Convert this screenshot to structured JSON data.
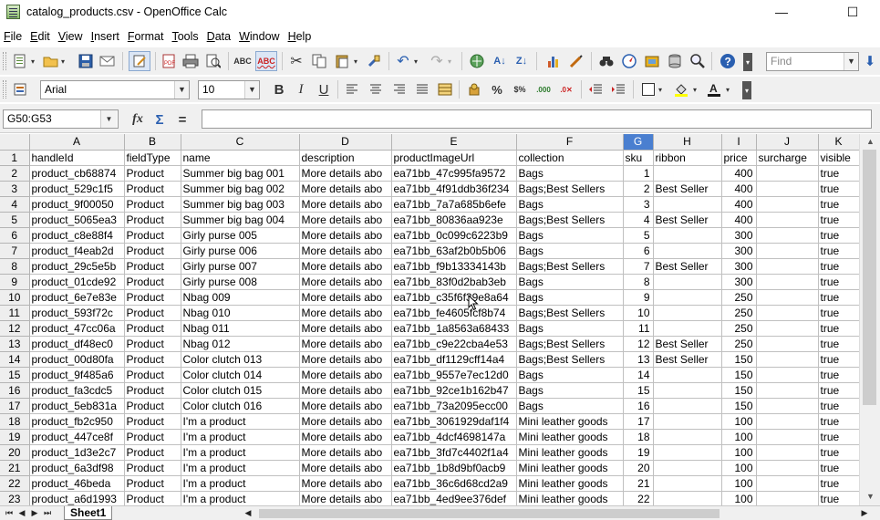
{
  "window": {
    "title": "catalog_products.csv - OpenOffice Calc",
    "minimize": "—",
    "maximize": "☐",
    "close": "✕"
  },
  "menu": [
    "File",
    "Edit",
    "View",
    "Insert",
    "Format",
    "Tools",
    "Data",
    "Window",
    "Help"
  ],
  "toolbar": {
    "find_placeholder": "Find",
    "font_name": "Arial",
    "font_size": "10"
  },
  "formula_bar": {
    "name_box": "G50:G53",
    "function_wizard": "fx",
    "sum": "Σ",
    "equals": "=",
    "formula": ""
  },
  "columns": [
    "A",
    "B",
    "C",
    "D",
    "E",
    "F",
    "G",
    "H",
    "I",
    "J",
    "K"
  ],
  "selected_column": "G",
  "rows": [
    {
      "n": "1",
      "cells": [
        "handleId",
        "fieldType",
        "name",
        "description",
        "productImageUrl",
        "collection",
        "sku",
        "ribbon",
        "price",
        "surcharge",
        "visible"
      ]
    },
    {
      "n": "2",
      "cells": [
        "product_cb68874",
        "Product",
        "Summer big bag 001",
        "More details abo",
        "ea71bb_47c995fa9572",
        "Bags",
        "1",
        "",
        "400",
        "",
        "true"
      ]
    },
    {
      "n": "3",
      "cells": [
        "product_529c1f5",
        "Product",
        "Summer big bag 002",
        "More details abo",
        "ea71bb_4f91ddb36f234",
        "Bags;Best Sellers",
        "2",
        "Best Seller",
        "400",
        "",
        "true"
      ]
    },
    {
      "n": "4",
      "cells": [
        "product_9f00050",
        "Product",
        "Summer big bag 003",
        "More details abo",
        "ea71bb_7a7a685b6efe",
        "Bags",
        "3",
        "",
        "400",
        "",
        "true"
      ]
    },
    {
      "n": "5",
      "cells": [
        "product_5065ea3",
        "Product",
        "Summer big bag 004",
        "More details abo",
        "ea71bb_80836aa923e",
        "Bags;Best Sellers",
        "4",
        "Best Seller",
        "400",
        "",
        "true"
      ]
    },
    {
      "n": "6",
      "cells": [
        "product_c8e88f4",
        "Product",
        "Girly purse 005",
        "More details abo",
        "ea71bb_0c099c6223b9",
        "Bags",
        "5",
        "",
        "300",
        "",
        "true"
      ]
    },
    {
      "n": "7",
      "cells": [
        "product_f4eab2d",
        "Product",
        "Girly purse 006",
        "More details abo",
        "ea71bb_63af2b0b5b06",
        "Bags",
        "6",
        "",
        "300",
        "",
        "true"
      ]
    },
    {
      "n": "8",
      "cells": [
        "product_29c5e5b",
        "Product",
        "Girly purse 007",
        "More details abo",
        "ea71bb_f9b13334143b",
        "Bags;Best Sellers",
        "7",
        "Best Seller",
        "300",
        "",
        "true"
      ]
    },
    {
      "n": "9",
      "cells": [
        "product_01cde92",
        "Product",
        "Girly purse 008",
        "More details abo",
        "ea71bb_83f0d2bab3eb",
        "Bags",
        "8",
        "",
        "300",
        "",
        "true"
      ]
    },
    {
      "n": "10",
      "cells": [
        "product_6e7e83e",
        "Product",
        "Nbag 009",
        "More details abo",
        "ea71bb_c35f6f39e8a64",
        "Bags",
        "9",
        "",
        "250",
        "",
        "true"
      ]
    },
    {
      "n": "11",
      "cells": [
        "product_593f72c",
        "Product",
        "Nbag 010",
        "More details abo",
        "ea71bb_fe4605fcf8b74",
        "Bags;Best Sellers",
        "10",
        "",
        "250",
        "",
        "true"
      ]
    },
    {
      "n": "12",
      "cells": [
        "product_47cc06a",
        "Product",
        "Nbag 011",
        "More details abo",
        "ea71bb_1a8563a68433",
        "Bags",
        "11",
        "",
        "250",
        "",
        "true"
      ]
    },
    {
      "n": "13",
      "cells": [
        "product_df48ec0",
        "Product",
        "Nbag 012",
        "More details abo",
        "ea71bb_c9e22cba4e53",
        "Bags;Best Sellers",
        "12",
        "Best Seller",
        "250",
        "",
        "true"
      ]
    },
    {
      "n": "14",
      "cells": [
        "product_00d80fa",
        "Product",
        "Color clutch 013",
        "More details abo",
        "ea71bb_df1129cff14a4",
        "Bags;Best Sellers",
        "13",
        "Best Seller",
        "150",
        "",
        "true"
      ]
    },
    {
      "n": "15",
      "cells": [
        "product_9f485a6",
        "Product",
        "Color clutch 014",
        "More details abo",
        "ea71bb_9557e7ec12d0",
        "Bags",
        "14",
        "",
        "150",
        "",
        "true"
      ]
    },
    {
      "n": "16",
      "cells": [
        "product_fa3cdc5",
        "Product",
        "Color clutch 015",
        "More details abo",
        "ea71bb_92ce1b162b47",
        "Bags",
        "15",
        "",
        "150",
        "",
        "true"
      ]
    },
    {
      "n": "17",
      "cells": [
        "product_5eb831a",
        "Product",
        "Color clutch 016",
        "More details abo",
        "ea71bb_73a2095ecc00",
        "Bags",
        "16",
        "",
        "150",
        "",
        "true"
      ]
    },
    {
      "n": "18",
      "cells": [
        "product_fb2c950",
        "Product",
        "I'm a product",
        "More details abo",
        "ea71bb_3061929daf1f4",
        "Mini leather goods",
        "17",
        "",
        "100",
        "",
        "true"
      ]
    },
    {
      "n": "19",
      "cells": [
        "product_447ce8f",
        "Product",
        "I'm a product",
        "More details abo",
        "ea71bb_4dcf4698147a",
        "Mini leather goods",
        "18",
        "",
        "100",
        "",
        "true"
      ]
    },
    {
      "n": "20",
      "cells": [
        "product_1d3e2c7",
        "Product",
        "I'm a product",
        "More details abo",
        "ea71bb_3fd7c4402f1a4",
        "Mini leather goods",
        "19",
        "",
        "100",
        "",
        "true"
      ]
    },
    {
      "n": "21",
      "cells": [
        "product_6a3df98",
        "Product",
        "I'm a product",
        "More details abo",
        "ea71bb_1b8d9bf0acb9",
        "Mini leather goods",
        "20",
        "",
        "100",
        "",
        "true"
      ]
    },
    {
      "n": "22",
      "cells": [
        "product_46beda",
        "Product",
        "I'm a product",
        "More details abo",
        "ea71bb_36c6d68cd2a9",
        "Mini leather goods",
        "21",
        "",
        "100",
        "",
        "true"
      ]
    },
    {
      "n": "23",
      "cells": [
        "product_a6d1993",
        "Product",
        "I'm a product",
        "More details abo",
        "ea71bb_4ed9ee376def",
        "Mini leather goods",
        "22",
        "",
        "100",
        "",
        "true"
      ]
    }
  ],
  "sheet_tab": "Sheet1"
}
